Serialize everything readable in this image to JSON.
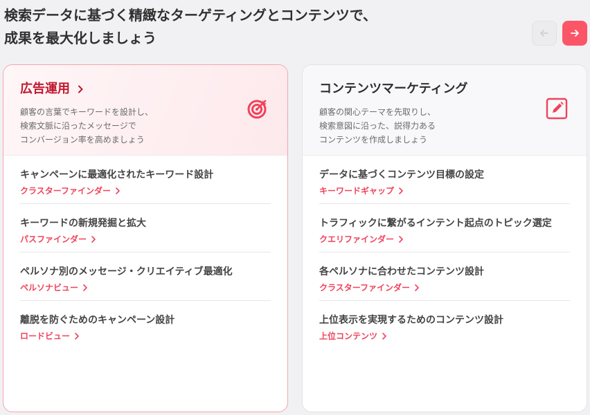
{
  "headline": {
    "line1": "検索データに基づく精緻なターゲティングとコンテンツで、",
    "line2": "成果を最大化しましょう"
  },
  "nav": {
    "prev_icon": "arrow-left-icon",
    "next_icon": "arrow-right-icon",
    "accent": "#fb5667"
  },
  "cards": [
    {
      "title": "広告運用",
      "desc": [
        "顧客の言葉でキーワードを設計し、",
        "検索文脈に沿ったメッセージで",
        "コンバージョン率を高めましょう"
      ],
      "icon": "target-icon",
      "items": [
        {
          "title": "キャンペーンに最適化されたキーワード設計",
          "link": "クラスターファインダー"
        },
        {
          "title": "キーワードの新規発掘と拡大",
          "link": "パスファインダー"
        },
        {
          "title": "ペルソナ別のメッセージ・クリエイティブ最適化",
          "link": "ペルソナビュー"
        },
        {
          "title": "離脱を防ぐためのキャンペーン設計",
          "link": "ロードビュー"
        }
      ]
    },
    {
      "title": "コンテンツマーケティング",
      "desc": [
        "顧客の関心テーマを先取りし、",
        "検索意図に沿った、説得力ある",
        "コンテンツを作成しましょう"
      ],
      "icon": "edit-icon",
      "items": [
        {
          "title": "データに基づくコンテンツ目標の設定",
          "link": "キーワードギャップ"
        },
        {
          "title": "トラフィックに繋がるインテント起点のトピック選定",
          "link": "クエリファインダー"
        },
        {
          "title": "各ペルソナに合わせたコンテンツ設計",
          "link": "クラスターファインダー"
        },
        {
          "title": "上位表示を実現するためのコンテンツ設計",
          "link": "上位コンテンツ"
        }
      ]
    }
  ]
}
